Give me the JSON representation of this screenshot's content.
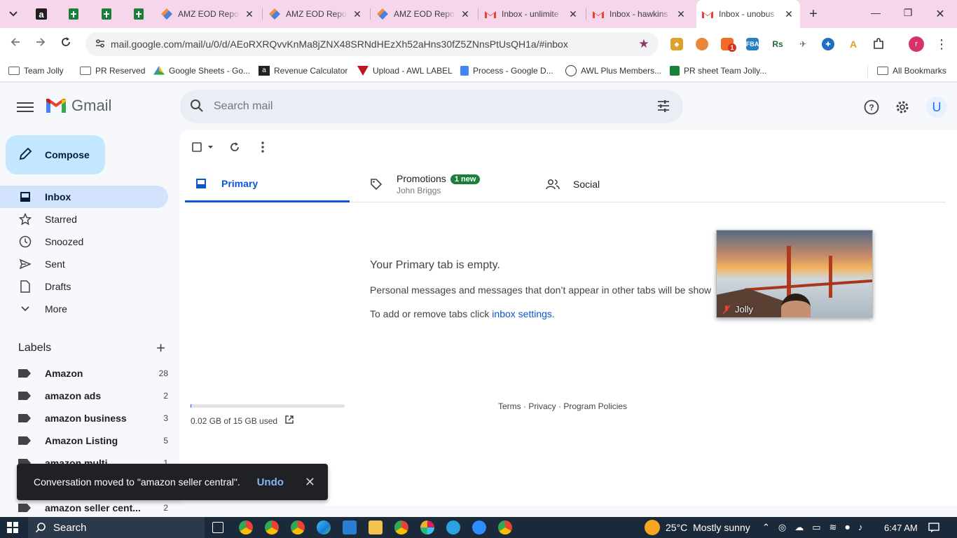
{
  "browser": {
    "tabs": [
      {
        "title": "AMZ EOD Repo",
        "icon": "eod-icon"
      },
      {
        "title": "AMZ EOD Repo",
        "icon": "eod-icon"
      },
      {
        "title": "AMZ EOD Repo",
        "icon": "eod-icon"
      },
      {
        "title": "Inbox - unlimite",
        "icon": "gmail-icon"
      },
      {
        "title": "Inbox - hawkins",
        "icon": "gmail-icon"
      },
      {
        "title": "Inbox - unobus",
        "icon": "gmail-icon",
        "active": true
      }
    ],
    "url": "mail.google.com/mail/u/0/d/AEoRXRQvvKnMa8jZNX48SRNdHEzXh52aHns30fZ5ZNnsPtUsQH1a/#inbox",
    "extension_badge": "1",
    "profile_initial": "r",
    "bookmarks": [
      {
        "label": "Team Jolly",
        "icon": "folder-icon"
      },
      {
        "label": "PR Reserved",
        "icon": "folder-icon"
      },
      {
        "label": "Google Sheets - Go...",
        "icon": "drive-icon"
      },
      {
        "label": "Revenue Calculator",
        "icon": "amazon-icon"
      },
      {
        "label": "Upload - AWL LABEL",
        "icon": "awl-icon"
      },
      {
        "label": "Process - Google D...",
        "icon": "docs-icon"
      },
      {
        "label": "AWL Plus Members...",
        "icon": "awl-plus-icon"
      },
      {
        "label": "PR sheet Team Jolly...",
        "icon": "sheets-icon"
      }
    ],
    "all_bookmarks": "All Bookmarks"
  },
  "gmail": {
    "logo_text": "Gmail",
    "search_placeholder": "Search mail",
    "account_initial": "U",
    "compose": "Compose",
    "nav": [
      {
        "label": "Inbox",
        "icon": "inbox-icon",
        "active": true
      },
      {
        "label": "Starred",
        "icon": "star-icon"
      },
      {
        "label": "Snoozed",
        "icon": "clock-icon"
      },
      {
        "label": "Sent",
        "icon": "send-icon"
      },
      {
        "label": "Drafts",
        "icon": "draft-icon"
      },
      {
        "label": "More",
        "icon": "chevron-down-icon"
      }
    ],
    "labels_title": "Labels",
    "labels": [
      {
        "name": "Amazon",
        "count": "28"
      },
      {
        "name": "amazon ads",
        "count": "2"
      },
      {
        "name": "amazon business",
        "count": "3"
      },
      {
        "name": "Amazon Listing",
        "count": "5"
      },
      {
        "name": "amazon multi",
        "count": "1"
      },
      {
        "name": "",
        "count": ""
      },
      {
        "name": "amazon seller cent...",
        "count": "2"
      }
    ],
    "tabs": {
      "primary": "Primary",
      "promotions": "Promotions",
      "promotions_badge": "1 new",
      "promotions_sender": "John Briggs",
      "social": "Social"
    },
    "empty": {
      "title": "Your Primary tab is empty.",
      "body": "Personal messages and messages that don’t appear in other tabs will be show",
      "settings_prefix": "To add or remove tabs click ",
      "settings_link": "inbox settings",
      "settings_suffix": "."
    },
    "storage": {
      "text": "0.02 GB of 15 GB used",
      "fraction": 0.0013
    },
    "footer": "Terms · Privacy · Program Policies",
    "video_name": "Jolly",
    "toast": {
      "message": "Conversation moved to \"amazon seller central\".",
      "undo": "Undo"
    }
  },
  "taskbar": {
    "search": "Search",
    "temp": "25°C",
    "weather": "Mostly sunny",
    "time": "6:47 AM"
  },
  "colors": {
    "accent": "#0b57d0",
    "compose_bg": "#c2e7ff",
    "active_nav": "#d3e3fd",
    "tabstrip": "#f5d6ea"
  }
}
